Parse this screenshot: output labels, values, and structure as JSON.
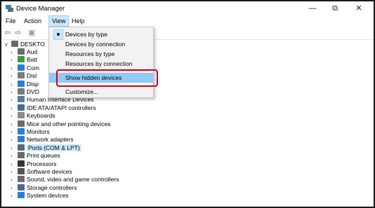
{
  "window": {
    "title": "Device Manager",
    "minimize": "—",
    "maximize": "⧉",
    "close": "✕"
  },
  "menubar": {
    "items": [
      "File",
      "Action",
      "View",
      "Help"
    ]
  },
  "toolbar": {
    "back": "⇦",
    "forward": "⇨",
    "view_icon": "▣",
    "help_icon": "?"
  },
  "view_menu": {
    "items": [
      {
        "label": "Devices by type",
        "checked": true
      },
      {
        "label": "Devices by connection"
      },
      {
        "label": "Resources by type"
      },
      {
        "label": "Resources by connection"
      },
      {
        "label": "Show hidden devices",
        "highlighted": true
      },
      {
        "label": "Customize..."
      }
    ]
  },
  "tree": {
    "root": "DESKTO",
    "items": [
      {
        "label": "Aud",
        "icon": "speaker-icon",
        "color": "#6a6a6a"
      },
      {
        "label": "Batt",
        "icon": "battery-icon",
        "color": "#3c9b3c"
      },
      {
        "label": "Com",
        "icon": "computer-icon",
        "color": "#2a7fd4"
      },
      {
        "label": "Disl",
        "icon": "disk-drive-icon",
        "color": "#7a7a7a"
      },
      {
        "label": "Disp",
        "icon": "display-adapter-icon",
        "color": "#2a7fd4"
      },
      {
        "label": "DVD",
        "icon": "dvd-icon",
        "color": "#7a7a7a"
      },
      {
        "label": "Human Interface Devices",
        "icon": "hid-icon",
        "color": "#5a7aa0"
      },
      {
        "label": "IDE ATA/ATAPI controllers",
        "icon": "ide-icon",
        "color": "#4a6a8a"
      },
      {
        "label": "Keyboards",
        "icon": "keyboard-icon",
        "color": "#8a8a8a"
      },
      {
        "label": "Mice and other pointing devices",
        "icon": "mouse-icon",
        "color": "#6a6a6a"
      },
      {
        "label": "Monitors",
        "icon": "monitor-icon",
        "color": "#2a7fd4"
      },
      {
        "label": "Network adapters",
        "icon": "network-icon",
        "color": "#2a7fd4"
      },
      {
        "label": "Ports (COM & LPT)",
        "icon": "port-icon",
        "color": "#5a6a7a",
        "selected": true
      },
      {
        "label": "Print queues",
        "icon": "printer-icon",
        "color": "#6a6a6a"
      },
      {
        "label": "Processors",
        "icon": "processor-icon",
        "color": "#333333"
      },
      {
        "label": "Software devices",
        "icon": "software-icon",
        "color": "#555555"
      },
      {
        "label": "Sound, video and game controllers",
        "icon": "sound-icon",
        "color": "#6a6a6a"
      },
      {
        "label": "Storage controllers",
        "icon": "storage-icon",
        "color": "#4a6a8a"
      },
      {
        "label": "System devices",
        "icon": "system-icon",
        "color": "#2a7fd4"
      }
    ]
  },
  "colors": {
    "callout": "#d0021b",
    "menu_highlight": "#91c9f7",
    "selection": "#cce8ff"
  }
}
